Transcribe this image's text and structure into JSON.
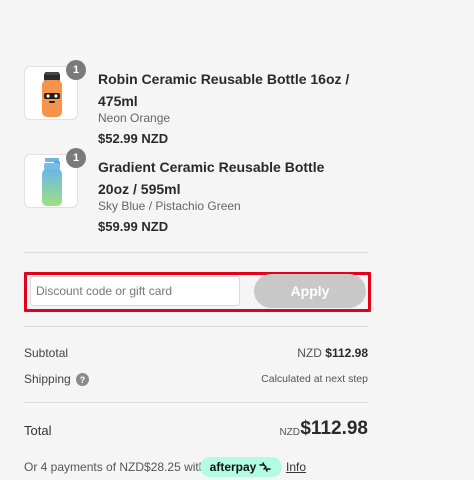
{
  "cart": {
    "items": [
      {
        "name": "Robin Ceramic Reusable Bottle 16oz / 475ml",
        "variant": "Neon Orange",
        "price": "$52.99 NZD",
        "quantity": "1",
        "image_icon": "orange-bottle-icon",
        "bottle_color": "#f7944b"
      },
      {
        "name": "Gradient Ceramic Reusable Bottle 20oz / 595ml",
        "variant": "Sky Blue / Pistachio Green",
        "price": "$59.99 NZD",
        "quantity": "1",
        "image_icon": "gradient-bottle-icon",
        "bottle_color_top": "#6bb6e8",
        "bottle_color_bottom": "#9fe07f"
      }
    ]
  },
  "discount": {
    "placeholder": "Discount code or gift card",
    "value": "",
    "apply_label": "Apply",
    "highlight_color": "#e3001b"
  },
  "summary": {
    "subtotal_label": "Subtotal",
    "subtotal_currency": "NZD",
    "subtotal_value": "$112.98",
    "shipping_label": "Shipping",
    "shipping_help_icon": "question-circle-icon",
    "shipping_value": "Calculated at next step",
    "total_label": "Total",
    "total_currency": "NZD",
    "total_value": "$112.98"
  },
  "afterpay": {
    "text": "Or 4 payments of NZD$28.25 with",
    "badge_label": "afterpay",
    "badge_color": "#b2fce4",
    "info_label": "Info"
  }
}
